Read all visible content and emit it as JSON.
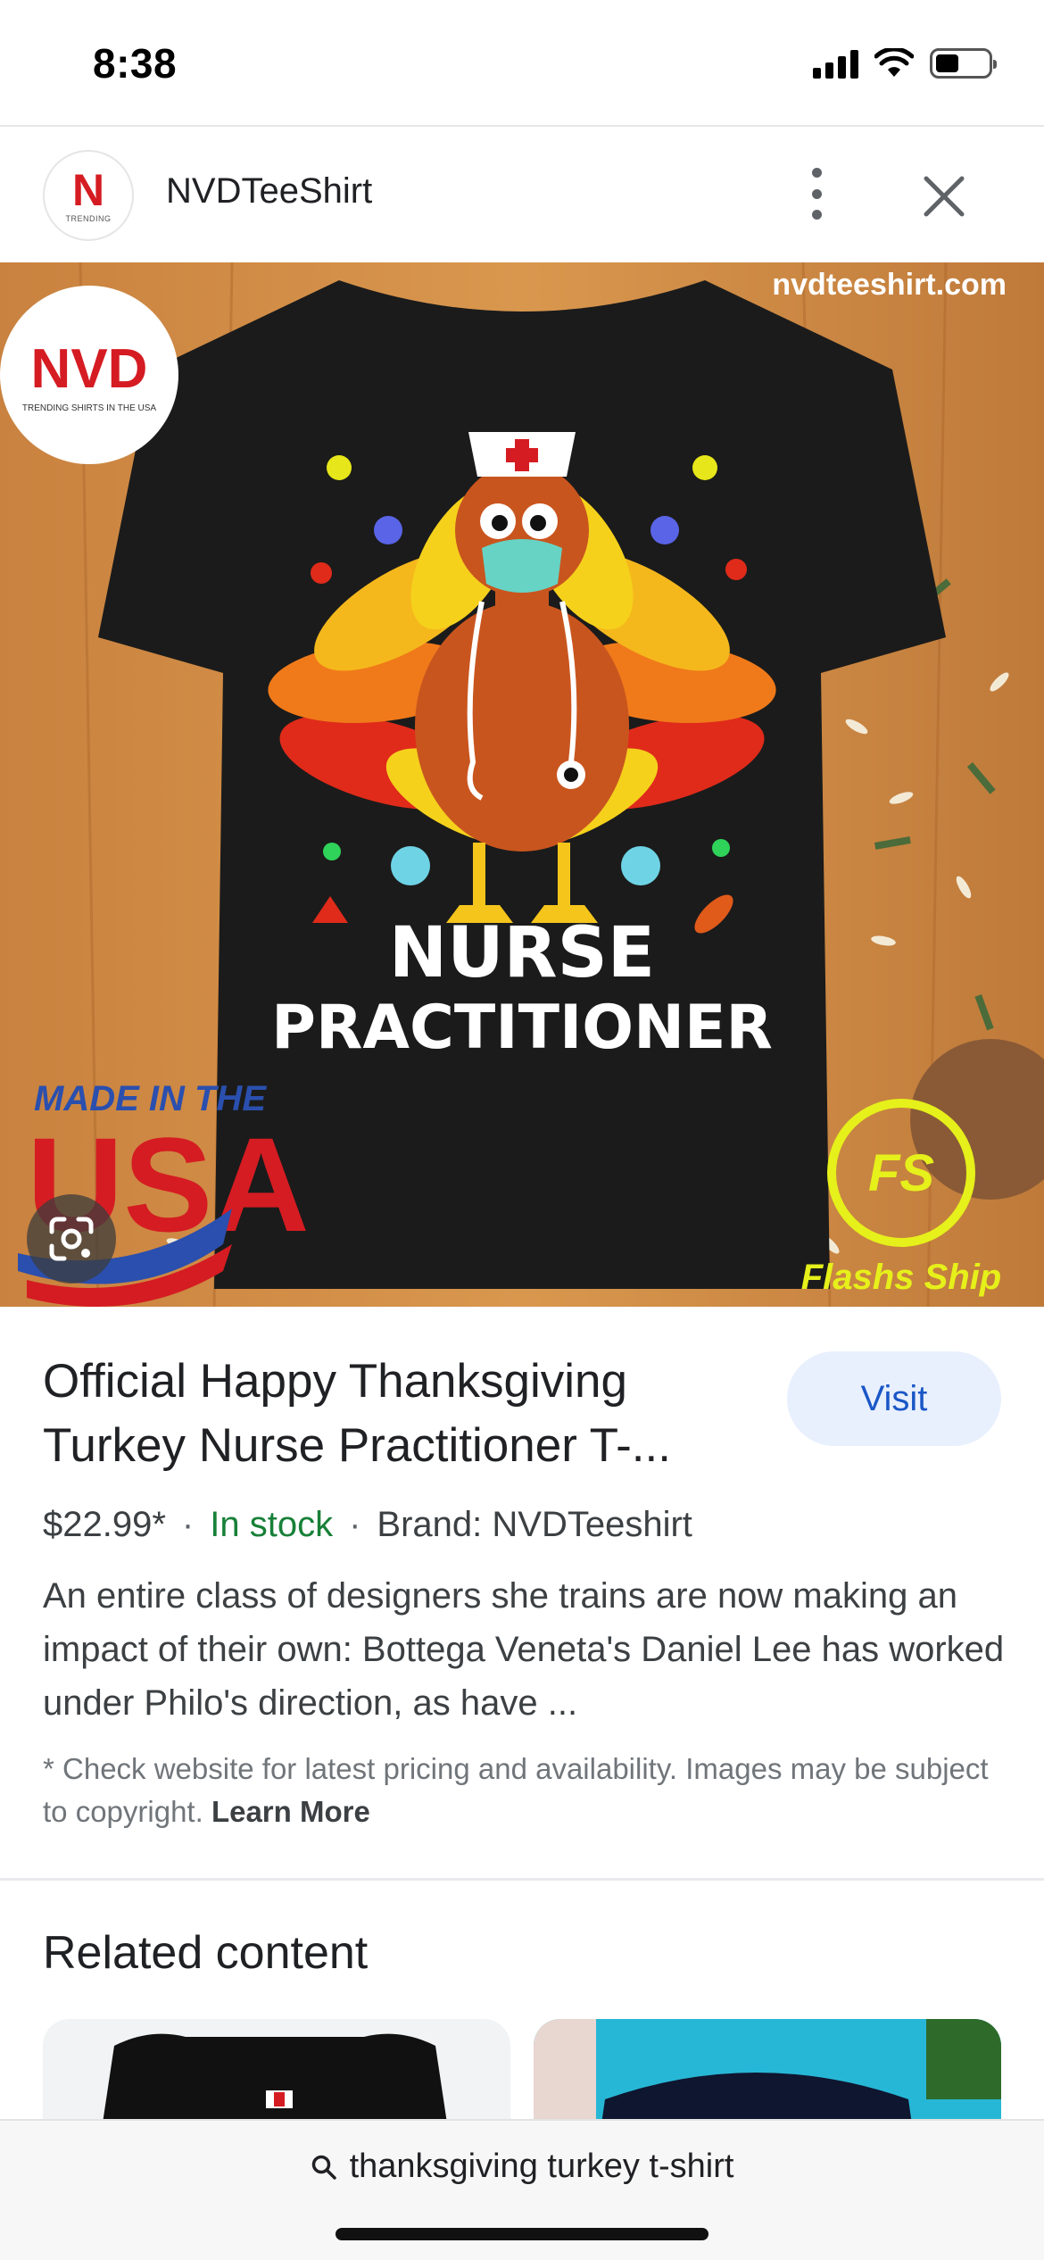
{
  "status_bar": {
    "time": "8:38"
  },
  "source": {
    "logo_letter": "N",
    "logo_sub": "TRENDING",
    "name": "NVDTeeShirt"
  },
  "hero_image": {
    "watermark": "nvdteeshirt.com",
    "badge_brand": "NVD",
    "badge_tagline": "TRENDING SHIRTS IN THE USA",
    "shirt_text_line1": "NURSE",
    "shirt_text_line2": "PRACTITIONER",
    "made_in": "MADE IN THE",
    "usa": "USA",
    "fs_logo": "FS",
    "fs_tagline": "Flashs Ship"
  },
  "product": {
    "title": "Official Happy Thanksgiving Turkey Nurse Practitioner T-...",
    "visit_label": "Visit",
    "price": "$22.99*",
    "stock": "In stock",
    "brand": "Brand: NVDTeeshirt",
    "description": "An entire class of designers she trains are now making an impact of their own: Bottega Veneta's Daniel Lee has worked under Philo's direction, as have ...",
    "disclaimer": "* Check website for latest pricing and availability. Images may be subject to copyright.",
    "learn_more": "Learn More"
  },
  "related": {
    "title": "Related content"
  },
  "search": {
    "query": "thanksgiving turkey t-shirt"
  },
  "colors": {
    "accent_blue": "#1a57c6",
    "visit_bg": "#e8f0fe",
    "stock_green": "#188038",
    "brand_red": "#d51c22"
  }
}
